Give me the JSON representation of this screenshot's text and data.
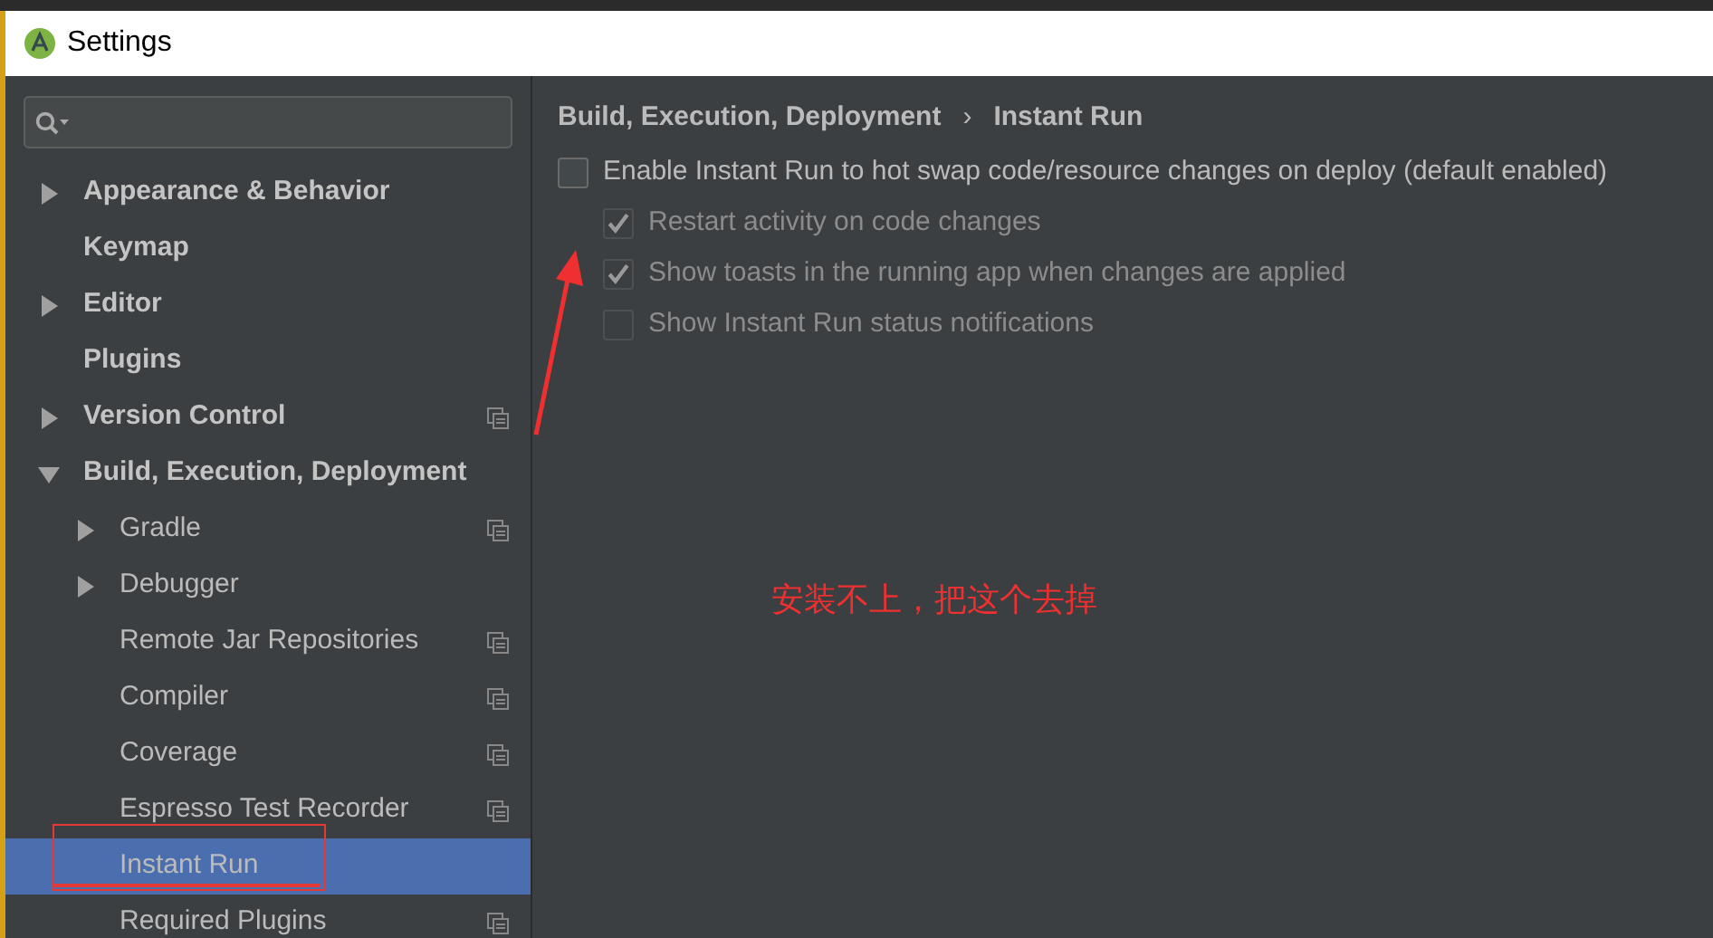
{
  "window": {
    "title": "Settings"
  },
  "tree": [
    {
      "label": "Appearance & Behavior",
      "expanded": false,
      "has_children": true,
      "project_scope": false,
      "selected": false
    },
    {
      "label": "Keymap",
      "has_children": false,
      "project_scope": false,
      "selected": false
    },
    {
      "label": "Editor",
      "expanded": false,
      "has_children": true,
      "project_scope": false,
      "selected": false
    },
    {
      "label": "Plugins",
      "has_children": false,
      "project_scope": false,
      "selected": false
    },
    {
      "label": "Version Control",
      "expanded": false,
      "has_children": true,
      "project_scope": true,
      "selected": false
    },
    {
      "label": "Build, Execution, Deployment",
      "expanded": true,
      "has_children": true,
      "project_scope": false,
      "selected": false,
      "children": [
        {
          "label": "Gradle",
          "expanded": false,
          "has_children": true,
          "project_scope": true,
          "selected": false
        },
        {
          "label": "Debugger",
          "expanded": false,
          "has_children": true,
          "project_scope": false,
          "selected": false
        },
        {
          "label": "Remote Jar Repositories",
          "has_children": false,
          "project_scope": true,
          "selected": false
        },
        {
          "label": "Compiler",
          "has_children": false,
          "project_scope": true,
          "selected": false
        },
        {
          "label": "Coverage",
          "has_children": false,
          "project_scope": true,
          "selected": false
        },
        {
          "label": "Espresso Test Recorder",
          "has_children": false,
          "project_scope": true,
          "selected": false
        },
        {
          "label": "Instant Run",
          "has_children": false,
          "project_scope": false,
          "selected": true
        },
        {
          "label": "Required Plugins",
          "has_children": false,
          "project_scope": true,
          "selected": false
        }
      ]
    }
  ],
  "breadcrumb": [
    "Build, Execution, Deployment",
    "Instant Run"
  ],
  "breadcrumb_separator": "›",
  "options": [
    {
      "label": "Enable Instant Run to hot swap code/resource changes on deploy (default enabled)",
      "checked": false,
      "disabled": false,
      "children": [
        {
          "label": "Restart activity on code changes",
          "checked": true,
          "disabled": true
        },
        {
          "label": "Show toasts in the running app when changes are applied",
          "checked": true,
          "disabled": true
        },
        {
          "label": "Show Instant Run status notifications",
          "checked": false,
          "disabled": true
        }
      ]
    }
  ],
  "annotation": {
    "text": "安装不上，把这个去掉"
  }
}
